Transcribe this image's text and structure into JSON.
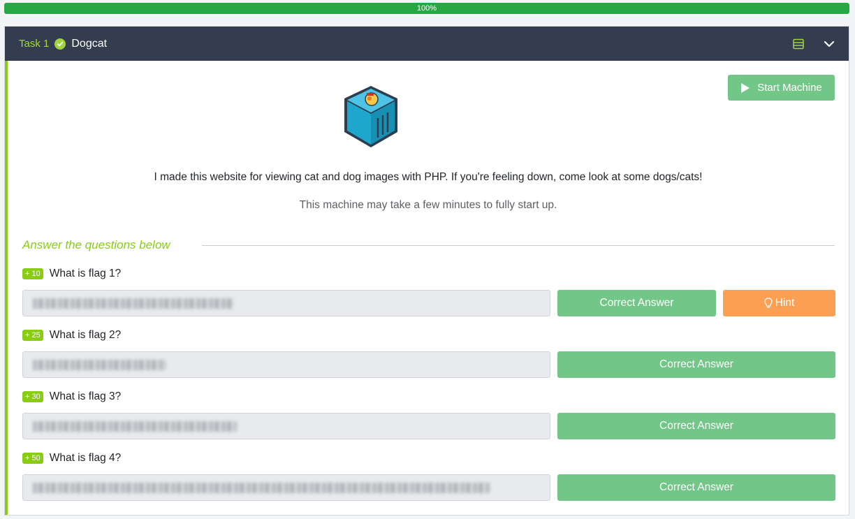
{
  "progress": {
    "label": "100%",
    "value_percent": 100,
    "color": "#28a745"
  },
  "task": {
    "number_label": "Task 1",
    "title": "Dogcat",
    "completed": true
  },
  "start_machine": {
    "label": "Start Machine"
  },
  "description": {
    "line1": "I made this website for viewing cat and dog images with PHP. If you're feeling down, come look at some dogs/cats!",
    "line2": "This machine may take a few minutes to fully start up."
  },
  "questions_section_title": "Answer the questions below",
  "questions": [
    {
      "points": "+ 10",
      "text": "What is flag 1?",
      "answer_button": "Correct Answer",
      "hint_button": "Hint"
    },
    {
      "points": "+ 25",
      "text": "What is flag 2?",
      "answer_button": "Correct Answer"
    },
    {
      "points": "+ 30",
      "text": "What is flag 3?",
      "answer_button": "Correct Answer"
    },
    {
      "points": "+ 50",
      "text": "What is flag 4?",
      "answer_button": "Correct Answer"
    }
  ],
  "colors": {
    "header_bg": "#343d4f",
    "accent_green": "#88cc14",
    "button_green": "#72c687",
    "hint_orange": "#fba052"
  }
}
